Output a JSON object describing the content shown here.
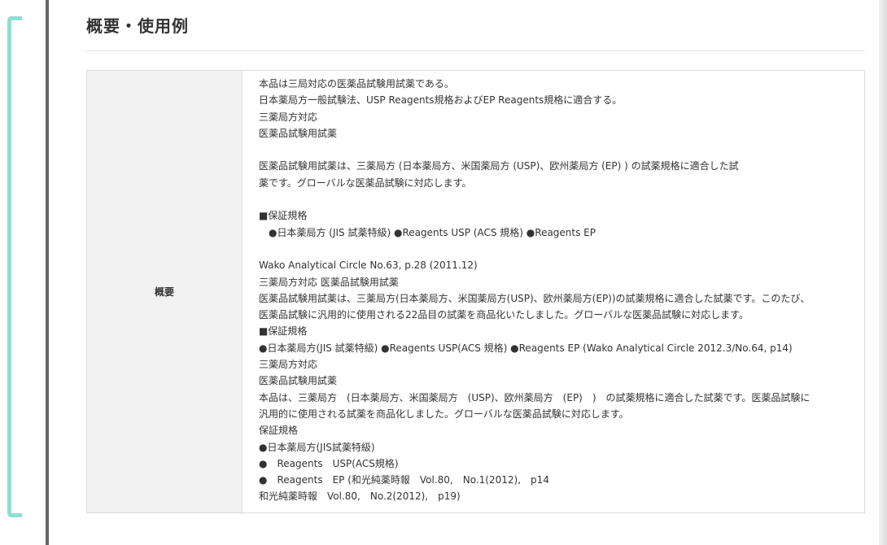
{
  "section": {
    "title": "概要・使用例"
  },
  "table": {
    "row_label": "概要",
    "lines": [
      "本品は三局対応の医薬品試験用試薬である。",
      "日本薬局方一般試験法、USP Reagents規格およびEP Reagents規格に適合する。",
      "三薬局方対応",
      "医薬品試験用試薬",
      "",
      "医薬品試験用試薬は、三薬局方 (日本薬局方、米国薬局方 (USP)、欧州薬局方 (EP) ) の試薬規格に適合した試",
      "薬です。グローバルな医薬品試験に対応します。",
      "",
      "■保証規格",
      "●日本薬局方 (JIS 試薬特級) ●Reagents USP (ACS 規格) ●Reagents EP",
      "",
      "Wako Analytical Circle No.63, p.28 (2011.12)",
      "三薬局方対応 医薬品試験用試薬",
      "医薬品試験用試薬は、三薬局方(日本薬局方、米国薬局方(USP)、欧州薬局方(EP))の試薬規格に適合した試薬です。このたび、",
      "医薬品試験に汎用的に使用される22品目の試薬を商品化いたしました。グローバルな医薬品試験に対応します。",
      "■保証規格",
      "●日本薬局方(JIS 試薬特級) ●Reagents USP(ACS 規格) ●Reagents EP (Wako Analytical Circle 2012.3/No.64, p14)",
      "三薬局方対応",
      "医薬品試験用試薬",
      "本品は、三薬局方　(日本薬局方、米国薬局方　(USP)、欧州薬局方　(EP)　)　の試薬規格に適合した試薬です。医薬品試験に",
      "汎用的に使用される試薬を商品化しました。グローバルな医薬品試験に対応します。",
      "保証規格",
      "●日本薬局方(JIS試薬特級)",
      "●　Reagents　USP(ACS規格)",
      "●　Reagents　EP (和光純薬時報　Vol.80,　No.1(2012),　p14",
      "和光純薬時報　Vol.80,　No.2(2012),　p19)"
    ]
  },
  "colors": {
    "accent_bracket": "#8fded5",
    "divider_line": "#666666",
    "header_cell_bg": "#f2f2f2",
    "border": "#dcdcdc",
    "text": "#333333"
  }
}
